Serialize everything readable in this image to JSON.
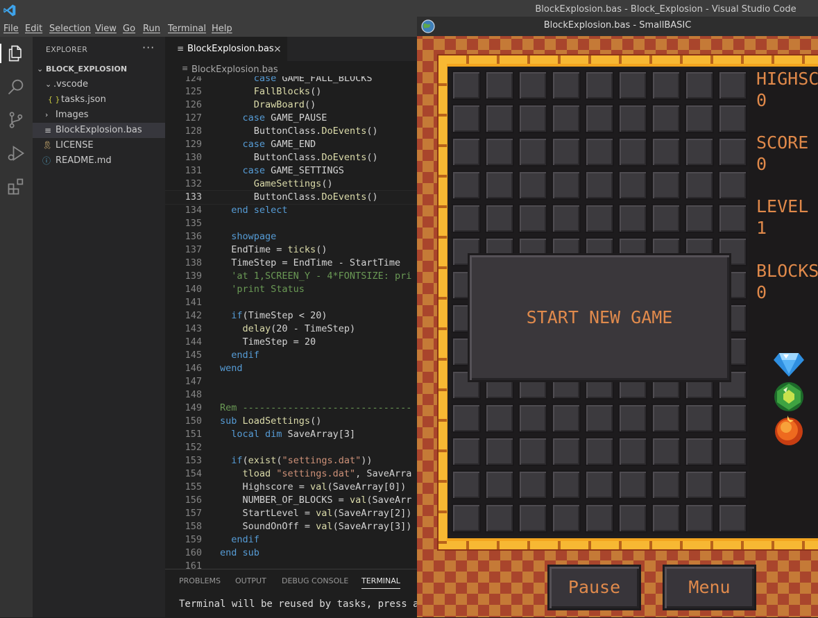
{
  "vscode": {
    "window_title": "BlockExplosion.bas - Block_Explosion - Visual Studio Code",
    "menu": [
      "File",
      "Edit",
      "Selection",
      "View",
      "Go",
      "Run",
      "Terminal",
      "Help"
    ],
    "explorer": {
      "title": "EXPLORER",
      "more": "···",
      "folder": "BLOCK_EXPLOSION",
      "items": [
        {
          "label": ".vscode",
          "icon": "chevron-down-icon"
        },
        {
          "label": "tasks.json",
          "icon": "json-icon",
          "glyph": "{ }"
        },
        {
          "label": "Images",
          "icon": "chevron-right-icon"
        },
        {
          "label": "BlockExplosion.bas",
          "icon": "file-lines-icon",
          "glyph": "≡"
        },
        {
          "label": "LICENSE",
          "icon": "license-icon",
          "glyph": "🎗"
        },
        {
          "label": "README.md",
          "icon": "info-icon",
          "glyph": "ⓘ"
        }
      ]
    },
    "tab": {
      "label": "BlockExplosion.bas",
      "close": "×",
      "glyph": "≡"
    },
    "breadcrumb": "BlockExplosion.bas",
    "code_lines": [
      {
        "n": "124",
        "code": "      case GAME_FALL_BLOCKS",
        "cut": true
      },
      {
        "n": "125",
        "code": "      FallBlocks()"
      },
      {
        "n": "126",
        "code": "      DrawBoard()"
      },
      {
        "n": "127",
        "code": "    case GAME_PAUSE"
      },
      {
        "n": "128",
        "code": "      ButtonClass.DoEvents()"
      },
      {
        "n": "129",
        "code": "    case GAME_END"
      },
      {
        "n": "130",
        "code": "      ButtonClass.DoEvents()"
      },
      {
        "n": "131",
        "code": "    case GAME_SETTINGS"
      },
      {
        "n": "132",
        "code": "      GameSettings()"
      },
      {
        "n": "133",
        "code": "      ButtonClass.DoEvents()",
        "current": true
      },
      {
        "n": "134",
        "code": "  end select"
      },
      {
        "n": "135",
        "code": ""
      },
      {
        "n": "136",
        "code": "  showpage"
      },
      {
        "n": "137",
        "code": "  EndTime = ticks()"
      },
      {
        "n": "138",
        "code": "  TimeStep = EndTime - StartTime"
      },
      {
        "n": "139",
        "code": "  'at 1,SCREEN_Y - 4*FONTSIZE: pri"
      },
      {
        "n": "140",
        "code": "  'print Status"
      },
      {
        "n": "141",
        "code": ""
      },
      {
        "n": "142",
        "code": "  if(TimeStep < 20)"
      },
      {
        "n": "143",
        "code": "    delay(20 - TimeStep)"
      },
      {
        "n": "144",
        "code": "    TimeStep = 20"
      },
      {
        "n": "145",
        "code": "  endif"
      },
      {
        "n": "146",
        "code": "wend"
      },
      {
        "n": "147",
        "code": ""
      },
      {
        "n": "148",
        "code": ""
      },
      {
        "n": "149",
        "code": "Rem ------------------------------"
      },
      {
        "n": "150",
        "code": "sub LoadSettings()"
      },
      {
        "n": "151",
        "code": "  local dim SaveArray[3]"
      },
      {
        "n": "152",
        "code": ""
      },
      {
        "n": "153",
        "code": "  if(exist(\"settings.dat\"))"
      },
      {
        "n": "154",
        "code": "    tload \"settings.dat\", SaveArra"
      },
      {
        "n": "155",
        "code": "    Highscore = val(SaveArray[0])"
      },
      {
        "n": "156",
        "code": "    NUMBER_OF_BLOCKS = val(SaveArr"
      },
      {
        "n": "157",
        "code": "    StartLevel = val(SaveArray[2])"
      },
      {
        "n": "158",
        "code": "    SoundOnOff = val(SaveArray[3])"
      },
      {
        "n": "159",
        "code": "  endif"
      },
      {
        "n": "160",
        "code": "end sub"
      },
      {
        "n": "161",
        "code": ""
      }
    ],
    "panel_tabs": [
      "PROBLEMS",
      "OUTPUT",
      "DEBUG CONSOLE",
      "TERMINAL"
    ],
    "active_panel_tab": "TERMINAL",
    "terminal_text": "Terminal will be reused by tasks, press any",
    "colors": {
      "keyword": "#569cd6",
      "function": "#dcdcaa",
      "string": "#ce9178",
      "comment": "#6a9955",
      "builtin": "#c586c0"
    }
  },
  "smallbasic": {
    "window_title": "BlockExplosion.bas - SmallBASIC",
    "stats": [
      {
        "label": "HIGHSCO",
        "value": "0"
      },
      {
        "label": "SCORE",
        "value": "0"
      },
      {
        "label": "LEVEL",
        "value": "1"
      },
      {
        "label": "BLOCKS",
        "value": "0"
      }
    ],
    "dialog_label": "START NEW GAME",
    "pause_label": "Pause",
    "menu_label": "Menu",
    "gems": [
      "diamond-gem-icon",
      "green-gem-icon",
      "orange-orb-icon"
    ],
    "text_color": "#e08a4c"
  }
}
